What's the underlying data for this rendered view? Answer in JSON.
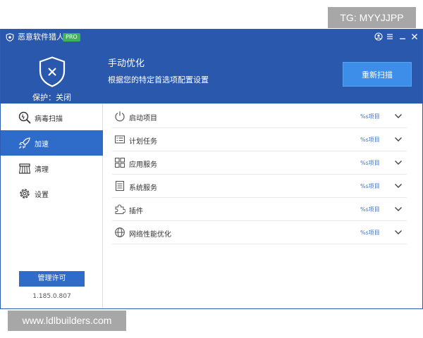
{
  "watermarks": {
    "top": "TG: MYYJJPP",
    "bottom": "www.ldlbuilders.com"
  },
  "titlebar": {
    "app_name": "恶意软件猎人",
    "badge": "PRO",
    "controls": [
      "user-icon",
      "menu-icon",
      "minimize-icon",
      "close-icon"
    ]
  },
  "header": {
    "protection_status": "保护：关闭",
    "title": "手动优化",
    "subtitle": "根据您的特定首选项配置设置",
    "rescan_label": "重新扫描"
  },
  "sidebar": {
    "items": [
      {
        "label": "病毒扫描",
        "icon": "virus-scan-icon",
        "active": false
      },
      {
        "label": "加速",
        "icon": "rocket-icon",
        "active": true
      },
      {
        "label": "清理",
        "icon": "broom-icon",
        "active": false
      },
      {
        "label": "设置",
        "icon": "gear-icon",
        "active": false
      }
    ],
    "license_button": "管理许可",
    "version": "1.185.0.807"
  },
  "content": {
    "rows": [
      {
        "label": "启动项目",
        "count": "%s项目",
        "icon": "power-icon"
      },
      {
        "label": "计划任务",
        "count": "%s项目",
        "icon": "task-list-icon"
      },
      {
        "label": "应用服务",
        "count": "%s项目",
        "icon": "apps-grid-icon"
      },
      {
        "label": "系统服务",
        "count": "%s项目",
        "icon": "document-icon"
      },
      {
        "label": "插件",
        "count": "%s项目",
        "icon": "puzzle-icon"
      },
      {
        "label": "网络性能优化",
        "count": "%s项目",
        "icon": "globe-icon"
      }
    ]
  },
  "colors": {
    "header_bg": "#2a58ad",
    "accent": "#2f6bc9",
    "rescan_bg": "#3d8ee8",
    "pro_badge": "#3cb35a",
    "count_text": "#3a74c9"
  }
}
